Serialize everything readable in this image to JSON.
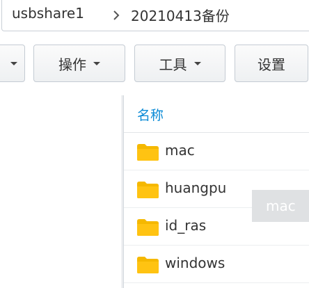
{
  "breadcrumb": {
    "root": "usbshare1",
    "separator_icon": "chevron-right-icon",
    "current": "20210413备份"
  },
  "toolbar": {
    "action_label": "操作",
    "tools_label": "工具",
    "settings_label": "设置"
  },
  "file_list": {
    "column_name": "名称",
    "items": [
      {
        "name": "mac",
        "icon": "folder-icon"
      },
      {
        "name": "huangpu",
        "icon": "folder-icon"
      },
      {
        "name": "id_ras",
        "icon": "folder-icon"
      },
      {
        "name": "windows",
        "icon": "folder-icon"
      }
    ]
  },
  "tooltip": {
    "text": "mac"
  },
  "colors": {
    "header_link": "#0a8ad6",
    "folder": "#f5b800",
    "tooltip_bg": "#dfe1e3"
  }
}
